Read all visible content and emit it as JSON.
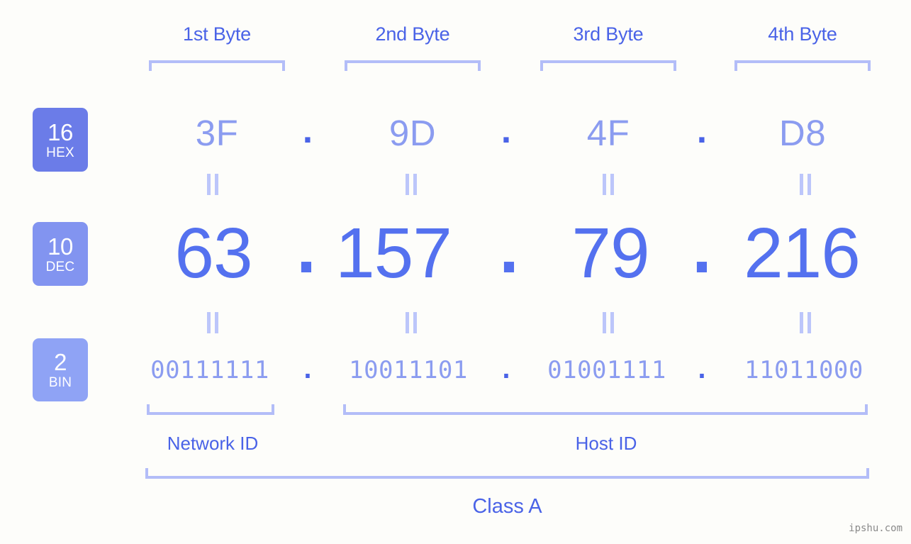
{
  "meta": {
    "background_color": "#fdfdfa",
    "accent_strong": "#4a63e7",
    "accent_mid": "#5471ef",
    "accent_light": "#8b9cf0",
    "accent_pale": "#b3bdf8",
    "watermark": "ipshu.com"
  },
  "byte_headers": [
    {
      "label": "1st Byte"
    },
    {
      "label": "2nd Byte"
    },
    {
      "label": "3rd Byte"
    },
    {
      "label": "4th Byte"
    }
  ],
  "rows": {
    "hex": {
      "badge_number": "16",
      "badge_name": "HEX",
      "separator": ".",
      "values": [
        "3F",
        "9D",
        "4F",
        "D8"
      ]
    },
    "dec": {
      "badge_number": "10",
      "badge_name": "DEC",
      "separator": ".",
      "values": [
        "63",
        "157",
        "79",
        "216"
      ]
    },
    "bin": {
      "badge_number": "2",
      "badge_name": "BIN",
      "separator": ".",
      "values": [
        "00111111",
        "10011101",
        "01001111",
        "11011000"
      ]
    }
  },
  "id_sections": {
    "network_id": "Network ID",
    "host_id": "Host ID"
  },
  "class_label": "Class A"
}
